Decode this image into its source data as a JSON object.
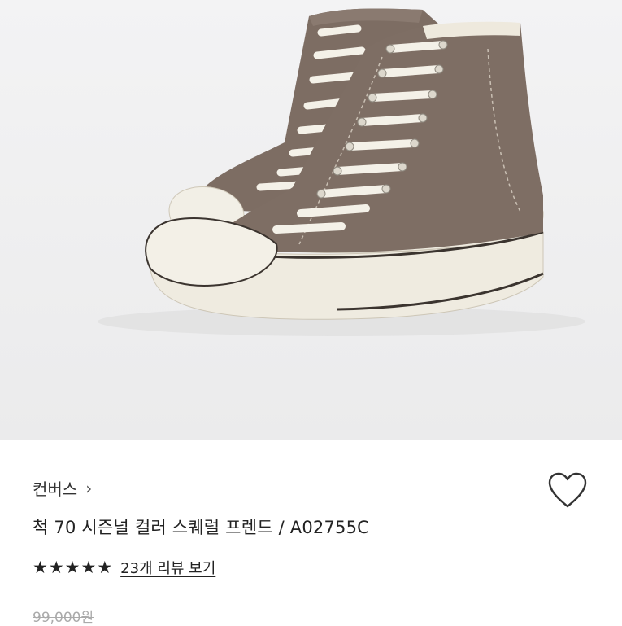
{
  "product": {
    "brand": "컨버스",
    "brand_chevron": "›",
    "title": "척 70 시즌널 컬러 스퀘럴 프렌드 / A02755C",
    "rating_stars": 5,
    "review_link": "23개 리뷰 보기",
    "original_price": "99,000원",
    "image_alt": "brown high-top canvas sneakers"
  },
  "icons": {
    "favorite": "heart-outline-icon",
    "star": "star-filled-icon"
  },
  "colors": {
    "canvas": "#7d6d63",
    "sole": "#efebe0",
    "background": "#ededee"
  }
}
